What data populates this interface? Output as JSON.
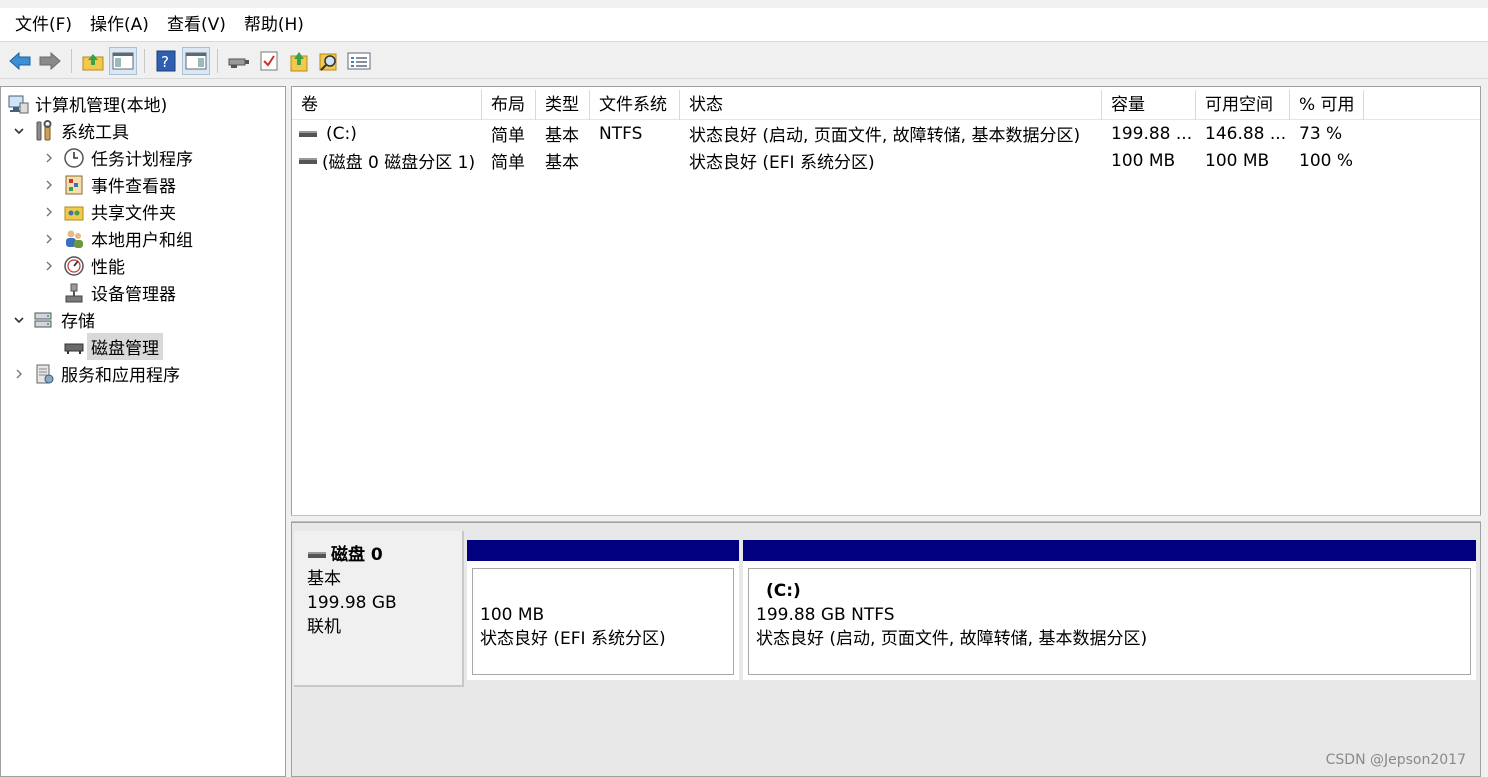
{
  "menu": [
    "文件(F)",
    "操作(A)",
    "查看(V)",
    "帮助(H)"
  ],
  "toolbar": {
    "buttons": [
      "back-icon",
      "forward-icon",
      "up-folder-icon",
      "show-hide-tree-icon",
      "help-icon",
      "show-hide-action-pane-icon",
      "connect-icon",
      "checklist-icon",
      "export-icon",
      "find-icon",
      "properties-icon"
    ]
  },
  "tree": {
    "root": "计算机管理(本地)",
    "system_tools": "系统工具",
    "task_scheduler": "任务计划程序",
    "event_viewer": "事件查看器",
    "shared_folders": "共享文件夹",
    "local_users": "本地用户和组",
    "performance": "性能",
    "device_manager": "设备管理器",
    "storage": "存储",
    "disk_management": "磁盘管理",
    "services_apps": "服务和应用程序"
  },
  "list": {
    "columns": [
      "卷",
      "布局",
      "类型",
      "文件系统",
      "状态",
      "容量",
      "可用空间",
      "% 可用"
    ],
    "rows": [
      [
        "(C:)",
        "简单",
        "基本",
        "NTFS",
        "状态良好 (启动, 页面文件, 故障转储, 基本数据分区)",
        "199.88 ...",
        "146.88 ...",
        "73 %"
      ],
      [
        "(磁盘 0 磁盘分区 1)",
        "简单",
        "基本",
        "",
        "状态良好 (EFI 系统分区)",
        "100 MB",
        "100 MB",
        "100 %"
      ]
    ]
  },
  "disk": {
    "name": "磁盘 0",
    "type": "基本",
    "size": "199.98 GB",
    "status": "联机",
    "partitions": [
      {
        "title": "",
        "size": "100 MB",
        "status": "状态良好 (EFI 系统分区)"
      },
      {
        "title": "(C:)",
        "size": "199.88 GB NTFS",
        "status": "状态良好 (启动, 页面文件, 故障转储, 基本数据分区)"
      }
    ]
  },
  "watermark": "CSDN @Jepson2017",
  "colors": {
    "partition_bar": "#000080",
    "selected": "#d9d9d9"
  }
}
